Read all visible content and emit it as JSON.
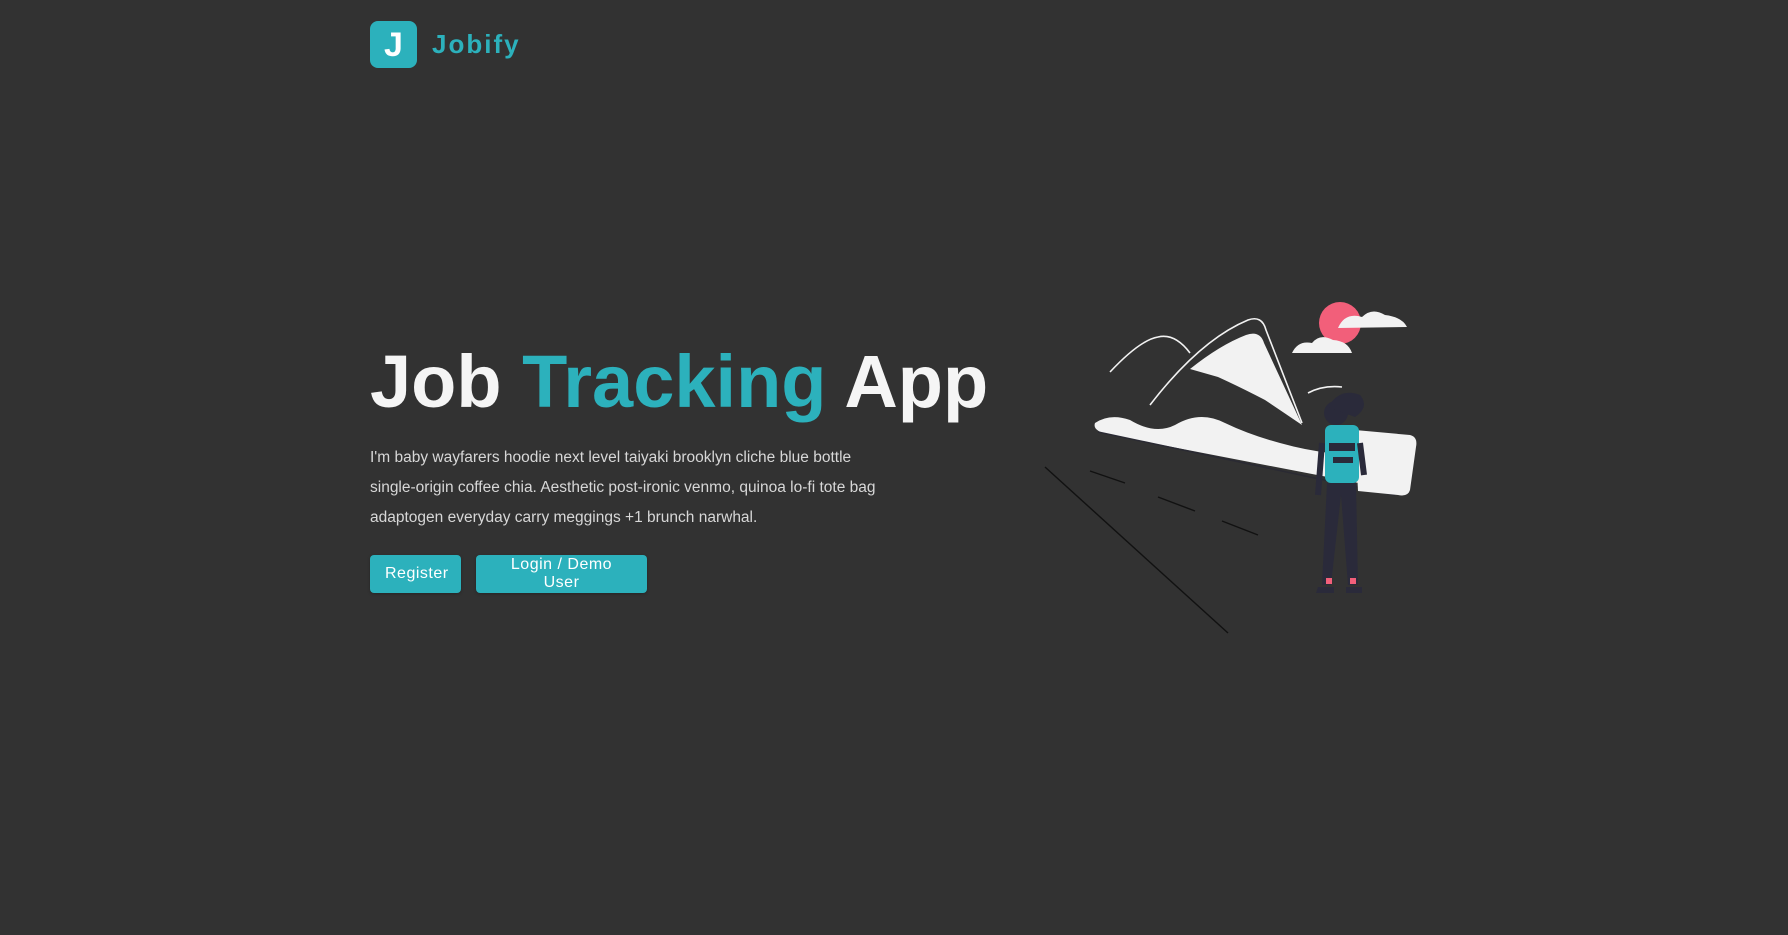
{
  "brand": {
    "logo_letter": "J",
    "name": "Jobify",
    "color": "#2cb1bc"
  },
  "hero": {
    "title_part1": "Job",
    "title_accent": "Tracking",
    "title_part2": "App",
    "description": "I'm baby wayfarers hoodie next level taiyaki brooklyn cliche blue bottle single-origin coffee chia. Aesthetic post-ironic venmo, quinoa lo-fi tote bag adaptogen everyday carry meggings +1 brunch narwhal.",
    "register_label": "Register",
    "login_label": "Login / Demo User"
  },
  "colors": {
    "background": "#323232",
    "accent": "#2cb1bc",
    "sun": "#f25f7a"
  }
}
